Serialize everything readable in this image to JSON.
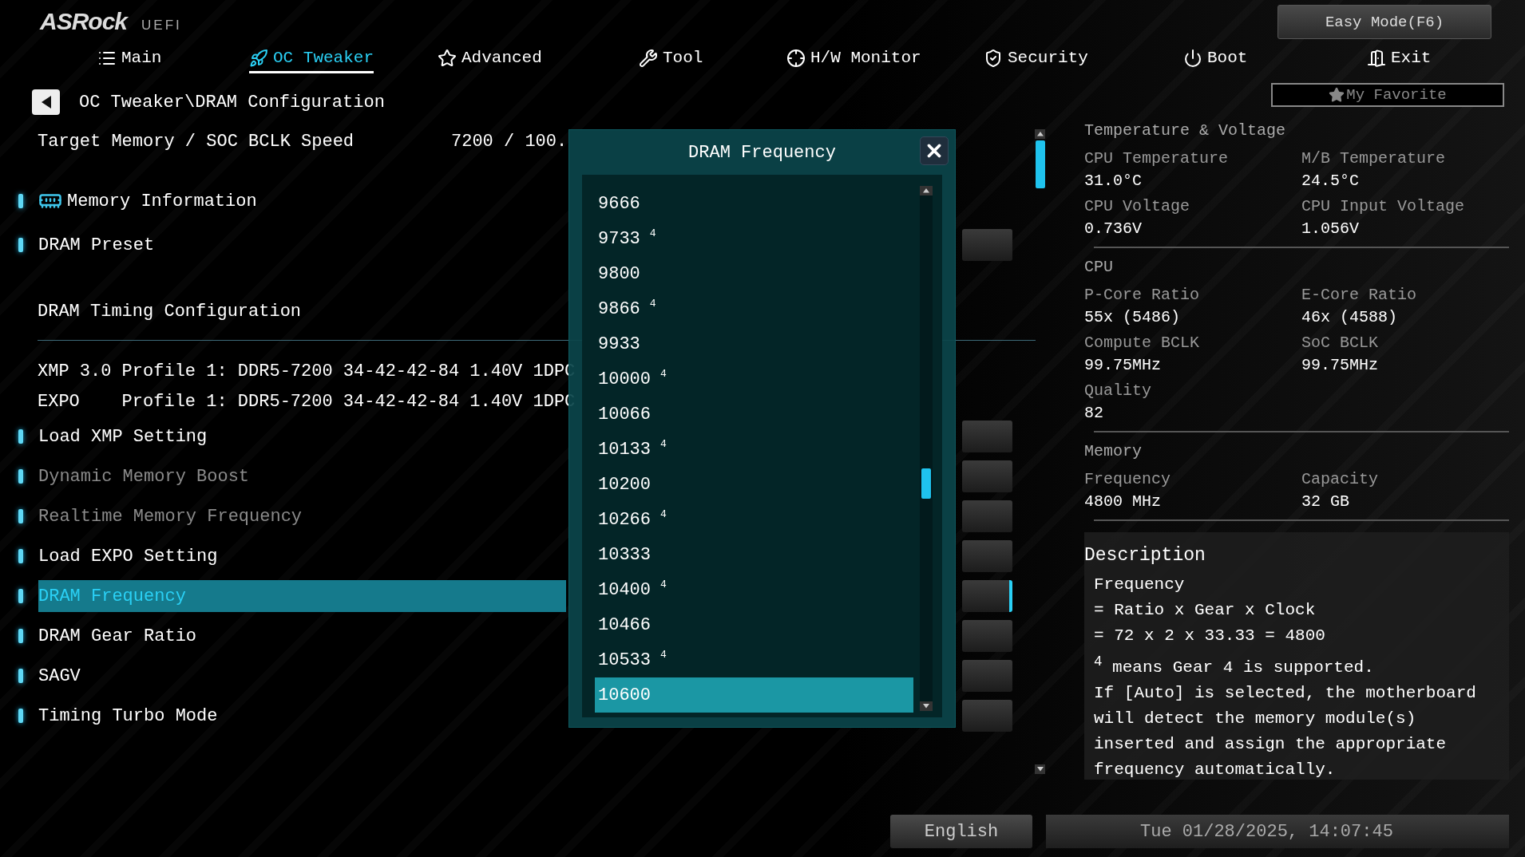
{
  "logo": {
    "brand": "ASRock",
    "suffix": "UEFI"
  },
  "easy_mode_button": "Easy Mode(F6)",
  "tabs": [
    {
      "label": "Main",
      "selected": false
    },
    {
      "label": "OC Tweaker",
      "selected": true
    },
    {
      "label": "Advanced",
      "selected": false
    },
    {
      "label": "Tool",
      "selected": false
    },
    {
      "label": "H/W Monitor",
      "selected": false
    },
    {
      "label": "Security",
      "selected": false
    },
    {
      "label": "Boot",
      "selected": false
    },
    {
      "label": "Exit",
      "selected": false
    }
  ],
  "breadcrumb": "OC Tweaker\\DRAM Configuration",
  "favorite_button": "My Favorite",
  "settings": {
    "target": {
      "label": "Target Memory / SOC BCLK Speed",
      "value": "7200 / 100."
    },
    "items": [
      {
        "kind": "submenu",
        "label": "Memory Information",
        "selected": false,
        "disabled": false
      },
      {
        "kind": "option",
        "label": "DRAM Preset",
        "selected": false,
        "disabled": false
      },
      {
        "kind": "heading",
        "label": "DRAM Timing Configuration"
      },
      {
        "kind": "profile",
        "label": "XMP 3.0 Profile 1: DDR5-7200 34-42-42-84 1.40V 1DPC"
      },
      {
        "kind": "profile",
        "label": "EXPO    Profile 1: DDR5-7200 34-42-42-84 1.40V 1DPC"
      },
      {
        "kind": "option",
        "label": "Load XMP Setting",
        "selected": false,
        "disabled": false
      },
      {
        "kind": "option",
        "label": "Dynamic Memory Boost",
        "selected": false,
        "disabled": true
      },
      {
        "kind": "option",
        "label": "Realtime Memory Frequency",
        "selected": false,
        "disabled": true
      },
      {
        "kind": "option",
        "label": "Load EXPO Setting",
        "selected": false,
        "disabled": false
      },
      {
        "kind": "option",
        "label": "DRAM Frequency",
        "selected": true,
        "disabled": false
      },
      {
        "kind": "option",
        "label": "DRAM Gear Ratio",
        "selected": false,
        "disabled": false
      },
      {
        "kind": "option",
        "label": "SAGV",
        "selected": false,
        "disabled": false
      },
      {
        "kind": "option",
        "label": "Timing Turbo Mode",
        "selected": false,
        "disabled": false
      }
    ]
  },
  "dialog": {
    "title": "DRAM Frequency",
    "options": [
      {
        "label": "9666",
        "selected": false
      },
      {
        "label": "9733",
        "note": "4",
        "selected": false
      },
      {
        "label": "9800",
        "selected": false
      },
      {
        "label": "9866",
        "note": "4",
        "selected": false
      },
      {
        "label": "9933",
        "selected": false
      },
      {
        "label": "10000",
        "note": "4",
        "selected": false
      },
      {
        "label": "10066",
        "selected": false
      },
      {
        "label": "10133",
        "note": "4",
        "selected": false
      },
      {
        "label": "10200",
        "selected": false
      },
      {
        "label": "10266",
        "note": "4",
        "selected": false
      },
      {
        "label": "10333",
        "selected": false
      },
      {
        "label": "10400",
        "note": "4",
        "selected": false
      },
      {
        "label": "10466",
        "selected": false
      },
      {
        "label": "10533",
        "note": "4",
        "selected": false
      },
      {
        "label": "10600",
        "selected": true
      }
    ]
  },
  "hardware_info": [
    {
      "title": "Temperature & Voltage",
      "fields": [
        {
          "label": "CPU Temperature",
          "value": "31.0°C"
        },
        {
          "label": "M/B Temperature",
          "value": "24.5°C"
        },
        {
          "label": "CPU Voltage",
          "value": "0.736V"
        },
        {
          "label": "CPU Input Voltage",
          "value": "1.056V"
        }
      ]
    },
    {
      "title": "CPU",
      "fields": [
        {
          "label": "P-Core Ratio",
          "value": "55x (5486)"
        },
        {
          "label": "E-Core Ratio",
          "value": "46x (4588)"
        },
        {
          "label": "Compute BCLK",
          "value": "99.75MHz"
        },
        {
          "label": "SoC BCLK",
          "value": "99.75MHz"
        },
        {
          "label": "Quality",
          "value": "82"
        }
      ]
    },
    {
      "title": "Memory",
      "fields": [
        {
          "label": "Frequency",
          "value": "4800 MHz"
        },
        {
          "label": "Capacity",
          "value": "32 GB"
        }
      ]
    }
  ],
  "description": {
    "title": "Description",
    "lines": [
      "Frequency",
      "= Ratio x Gear x Clock",
      "= 72 x 2 x 33.33 = 4800",
      "$^{4}$ means Gear 4 is supported."
    ],
    "paragraph": "If [Auto] is selected, the motherboard will detect the memory module(s) inserted and assign the appropriate frequency automatically."
  },
  "footer": {
    "language": "English",
    "datetime": "Tue 01/28/2025, 14:07:45"
  }
}
